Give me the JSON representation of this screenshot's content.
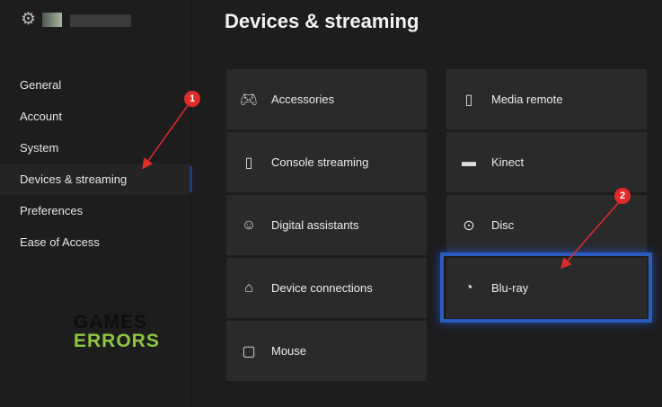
{
  "header": {
    "title": "Devices & streaming"
  },
  "sidebar": {
    "items": [
      {
        "label": "General"
      },
      {
        "label": "Account"
      },
      {
        "label": "System"
      },
      {
        "label": "Devices & streaming",
        "active": true
      },
      {
        "label": "Preferences"
      },
      {
        "label": "Ease of Access"
      }
    ]
  },
  "tiles": {
    "left": [
      {
        "label": "Accessories",
        "icon": "controller-icon"
      },
      {
        "label": "Console streaming",
        "icon": "phone-icon"
      },
      {
        "label": "Digital assistants",
        "icon": "assistant-icon"
      },
      {
        "label": "Device connections",
        "icon": "device-connections-icon"
      },
      {
        "label": "Mouse",
        "icon": "mouse-icon"
      }
    ],
    "right": [
      {
        "label": "Media remote",
        "icon": "remote-icon"
      },
      {
        "label": "Kinect",
        "icon": "kinect-icon"
      },
      {
        "label": "Disc",
        "icon": "disc-icon"
      },
      {
        "label": "Blu-ray",
        "icon": "bluray-icon",
        "selected": true
      }
    ]
  },
  "annotations": {
    "step1": "1",
    "step2": "2"
  },
  "watermark": {
    "line1": "GAMES",
    "line2": "ERRORS"
  },
  "colors": {
    "accent": "#2a5bbf",
    "annotation": "#e02b2b",
    "logo_green": "#8dc63f"
  }
}
